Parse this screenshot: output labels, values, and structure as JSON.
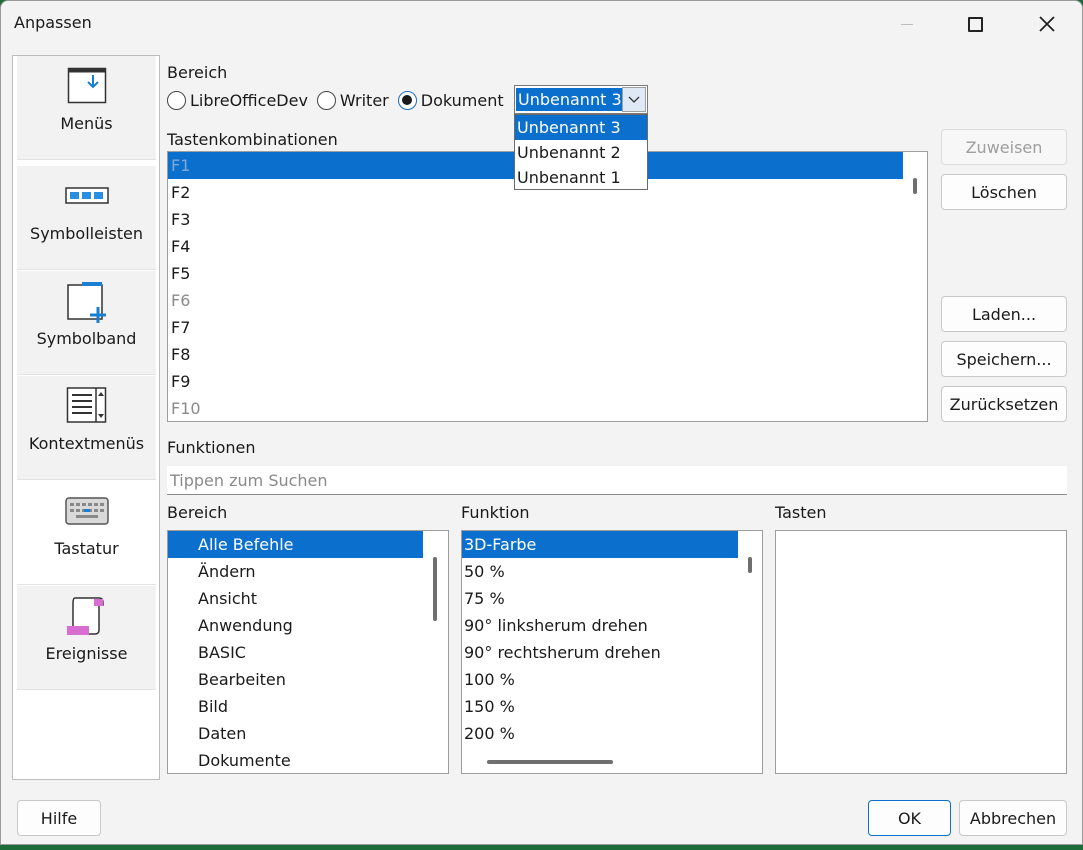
{
  "window": {
    "title": "Anpassen"
  },
  "sidebar": {
    "items": [
      {
        "label": "Menüs",
        "icon": "menu-icon"
      },
      {
        "label": "Symbolleisten",
        "icon": "toolbar-icon"
      },
      {
        "label": "Symbolband",
        "icon": "notebookbar-icon"
      },
      {
        "label": "Kontextmenüs",
        "icon": "context-menu-icon"
      },
      {
        "label": "Tastatur",
        "icon": "keyboard-icon",
        "selected": true
      },
      {
        "label": "Ereignisse",
        "icon": "events-scroll-icon"
      }
    ]
  },
  "scope": {
    "label": "Bereich",
    "options": [
      "LibreOfficeDev",
      "Writer",
      "Dokument"
    ],
    "selected": "Dokument",
    "combo_value": "Unbenannt 3",
    "combo_options": [
      "Unbenannt 3",
      "Unbenannt 2",
      "Unbenannt 1"
    ]
  },
  "shortcuts": {
    "label": "Tastenkombinationen",
    "items": [
      "F1",
      "F2",
      "F3",
      "F4",
      "F5",
      "F6",
      "F7",
      "F8",
      "F9",
      "F10"
    ]
  },
  "actions": {
    "assign": "Zuweisen",
    "delete": "Löschen",
    "load": "Laden...",
    "save": "Speichern...",
    "reset": "Zurücksetzen"
  },
  "functions": {
    "label": "Funktionen",
    "search_placeholder": "Tippen zum Suchen",
    "category_label": "Bereich",
    "function_label": "Funktion",
    "keys_label": "Tasten",
    "categories": [
      "Alle Befehle",
      "Ändern",
      "Ansicht",
      "Anwendung",
      "BASIC",
      "Bearbeiten",
      "Bild",
      "Daten",
      "Dokumente"
    ],
    "commands": [
      "3D-Farbe",
      "50 %",
      "75 %",
      "90° linksherum drehen",
      "90° rechtsherum drehen",
      "100 %",
      "150 %",
      "200 %"
    ]
  },
  "footer": {
    "help": "Hilfe",
    "ok": "OK",
    "cancel": "Abbrechen"
  },
  "colors": {
    "accent": "#0b6fce",
    "icon_blue": "#1a7fd0",
    "icon_pink": "#d86fd0"
  }
}
